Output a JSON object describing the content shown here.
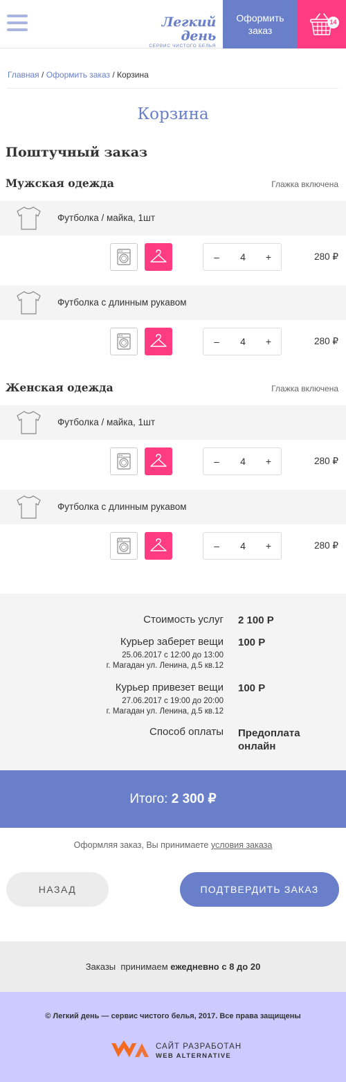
{
  "header": {
    "logo_title": "Легкий день",
    "logo_subtitle": "СЕРВИС ЧИСТОГО БЕЛЬЯ",
    "order_button": "Оформить заказ",
    "cart_count": "14",
    "brand_color": "#6a7fc9",
    "accent_color": "#ff3b82"
  },
  "breadcrumb": {
    "home": "Главная",
    "sep1": " / ",
    "order": "Оформить заказ",
    "sep2": " / ",
    "current": "Корзина"
  },
  "page_title": "Корзина",
  "order_type": "Поштучный заказ",
  "sections": [
    {
      "title": "Мужская одежда",
      "note": "Глажка включена",
      "items": [
        {
          "name": "Футболка / майка, 1шт",
          "qty": "4",
          "price": "280 ₽",
          "icon": "tshirt-icon"
        },
        {
          "name": "Футболка с длинным рукавом",
          "qty": "4",
          "price": "280 ₽",
          "icon": "tshirt-icon"
        }
      ]
    },
    {
      "title": "Женская одежда",
      "note": "Глажка включена",
      "items": [
        {
          "name": "Футболка / майка, 1шт",
          "qty": "4",
          "price": "280 ₽",
          "icon": "tshirt-icon"
        },
        {
          "name": "Футболка с длинным рукавом",
          "qty": "4",
          "price": "280 ₽",
          "icon": "tshirt-icon"
        }
      ]
    }
  ],
  "controls": {
    "minus": "–",
    "plus": "+"
  },
  "summary": {
    "services_label": "Стоимость услуг",
    "services_value": "2 100 Р",
    "pickup_label": "Курьер заберет вещи",
    "pickup_value": "100 Р",
    "pickup_time": "25.06.2017 с 12:00 до 13:00",
    "pickup_address": "г. Магадан ул. Ленина, д.5 кв.12",
    "delivery_label": "Курьер привезет вещи",
    "delivery_value": "100 Р",
    "delivery_time": "27.06.2017 с 19:00 до 20:00",
    "delivery_address": "г. Магадан ул. Ленина, д.5 кв.12",
    "payment_label": "Способ оплаты",
    "payment_value_line1": "Предоплата",
    "payment_value_line2": "онлайн"
  },
  "total": {
    "label": "Итого: ",
    "value": "2 300 ₽"
  },
  "terms": {
    "text": "Оформляя заказ, Вы принимаете ",
    "link": "условия заказа"
  },
  "buttons": {
    "back": "НАЗАД",
    "confirm": "ПОДТВЕРДИТЬ ЗАКАЗ"
  },
  "hours": {
    "prefix": "Заказы  принимаем ",
    "bold": "ежедневно с 8 до 20"
  },
  "footer": {
    "copyright": "© Легкий день — сервис чистого белья, 2017. Все права защищены",
    "dev_line1": "САЙТ РАЗРАБОТАН",
    "dev_line2": "WEB ALTERNATIVE"
  }
}
